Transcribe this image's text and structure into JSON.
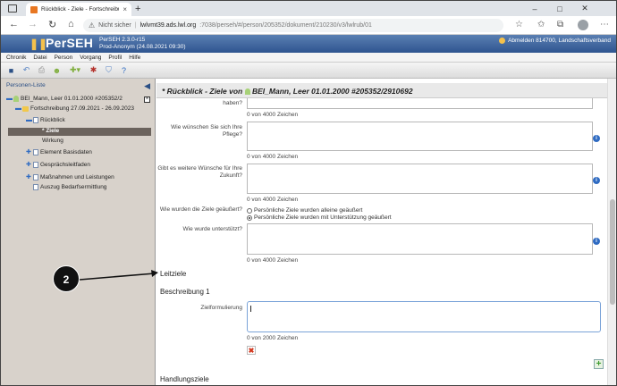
{
  "browser": {
    "tab_title": "Rückblick - Ziele - Fortschreibung",
    "new_tab": "+",
    "window_controls": {
      "minimize": "–",
      "maximize": "□",
      "close": "✕"
    },
    "url_warning": "Nicht sicher",
    "url_host": "lwlvmt39.ads.lwl.org",
    "url_path": ":7038/perseh/#/person/205352/dokument/210230/v3/lwlrub/01",
    "icons": [
      "back-icon",
      "forward-icon",
      "reload-icon",
      "home-icon",
      "star-icon",
      "favorites-icon",
      "collections-icon",
      "profile-icon",
      "more-icon"
    ]
  },
  "app": {
    "logo": "PerSEH",
    "version_line1": "PerSEH 2.3.0-r15",
    "version_line2": "Prod-Anonym (24.08.2021 09:30)",
    "user_text": "Abmelden 814700, Landschaftsverband",
    "colors": {
      "header": "#2f5590",
      "sidebar": "#d8d2cb",
      "accent": "#2f6bc2"
    }
  },
  "menu": [
    "Chronik",
    "Datei",
    "Person",
    "Vorgang",
    "Profil",
    "Hilfe"
  ],
  "toolbar_icons": [
    "save-icon",
    "undo-icon",
    "print-icon",
    "person-icon",
    "add-dropdown-icon",
    "tools-icon",
    "filter-icon",
    "help-icon"
  ],
  "sidebar": {
    "header": "Personen-Liste",
    "items": [
      {
        "label": "BEI_Mann, Leer 01.01.2000 #205352/2",
        "level": 0
      },
      {
        "label": "Fortschreibung 27.09.2021 - 26.09.2023",
        "level": 1
      },
      {
        "label": "Rückblick",
        "level": 2
      },
      {
        "label": "* Ziele",
        "level": 3,
        "selected": true
      },
      {
        "label": "Wirkung",
        "level": 3
      },
      {
        "label": "Element Basisdaten",
        "level": 2
      },
      {
        "label": "Gesprächsleitfaden",
        "level": 2
      },
      {
        "label": "Maßnahmen und Leistungen",
        "level": 2
      },
      {
        "label": "Auszug Bedarfsermittlung",
        "level": 2
      }
    ]
  },
  "page": {
    "title": "* Rückblick - Ziele von",
    "title_person": "BEI_Mann, Leer 01.01.2000 #205352/2910692",
    "fields": [
      {
        "label": "haben?",
        "counter": "0 von 4000 Zeichen"
      },
      {
        "label": "Wie wünschen Sie sich Ihre Pflege?",
        "counter": "0 von 4000 Zeichen"
      },
      {
        "label": "Gibt es weitere Wünsche für Ihre Zukunft?",
        "counter": "0 von 4000 Zeichen"
      },
      {
        "label": "Wie wurden die Ziele geäußert?",
        "options": [
          "Persönliche Ziele wurden alleine geäußert",
          "Persönliche Ziele wurden mit Unterstützung geäußert"
        ],
        "selected": 1
      },
      {
        "label": "Wie wurde unterstützt?",
        "counter": "0 von 4000 Zeichen"
      }
    ],
    "section_leitziele": "Leitziele",
    "beschreibung": "Beschreibung 1",
    "zielformulierung_label": "Zielformulierung",
    "zielformulierung_counter": "0 von 2000 Zeichen",
    "section_handlungsziele": "Handlungsziele",
    "delete": "✖",
    "add": "+",
    "info": "i"
  },
  "annotation": {
    "badge": "2"
  }
}
